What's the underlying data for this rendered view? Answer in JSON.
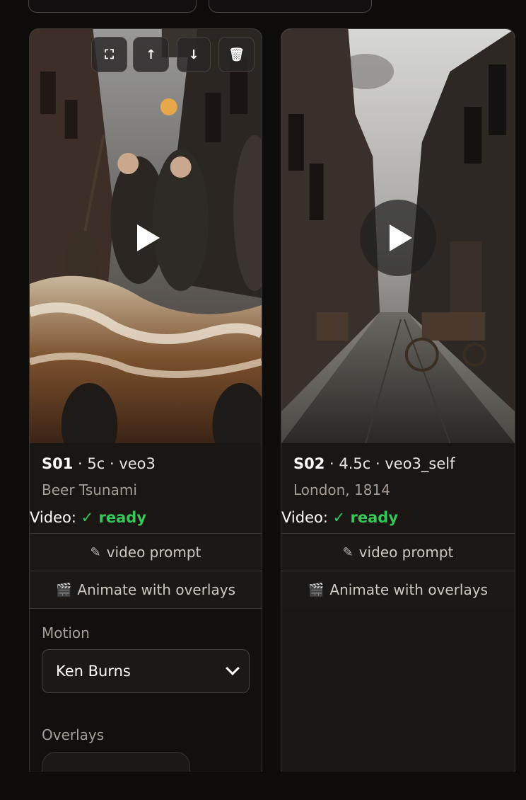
{
  "cards": [
    {
      "id": "S01",
      "meta": " · 5c · veo3",
      "title": "Beer Tsunami",
      "video_label": "Video:",
      "video_status": "✓ ready",
      "prompt_label": "video prompt",
      "animate_label": "Animate with overlays",
      "motion_label": "Motion",
      "motion_value": "Ken Burns",
      "overlays_label": "Overlays"
    },
    {
      "id": "S02",
      "meta": " · 4.5c · veo3_self",
      "title": "London, 1814",
      "video_label": "Video:",
      "video_status": "✓ ready",
      "prompt_label": "video prompt",
      "animate_label": "Animate with overlays"
    }
  ],
  "icons": {
    "prompt": "pencil-icon",
    "animate": "clapperboard-icon",
    "expand": "expand-icon",
    "up": "arrow-up-icon",
    "down": "arrow-down-icon",
    "delete": "trash-icon"
  },
  "colors": {
    "ready": "#34c759",
    "background": "#0e0c0b",
    "card": "#1a1614"
  }
}
